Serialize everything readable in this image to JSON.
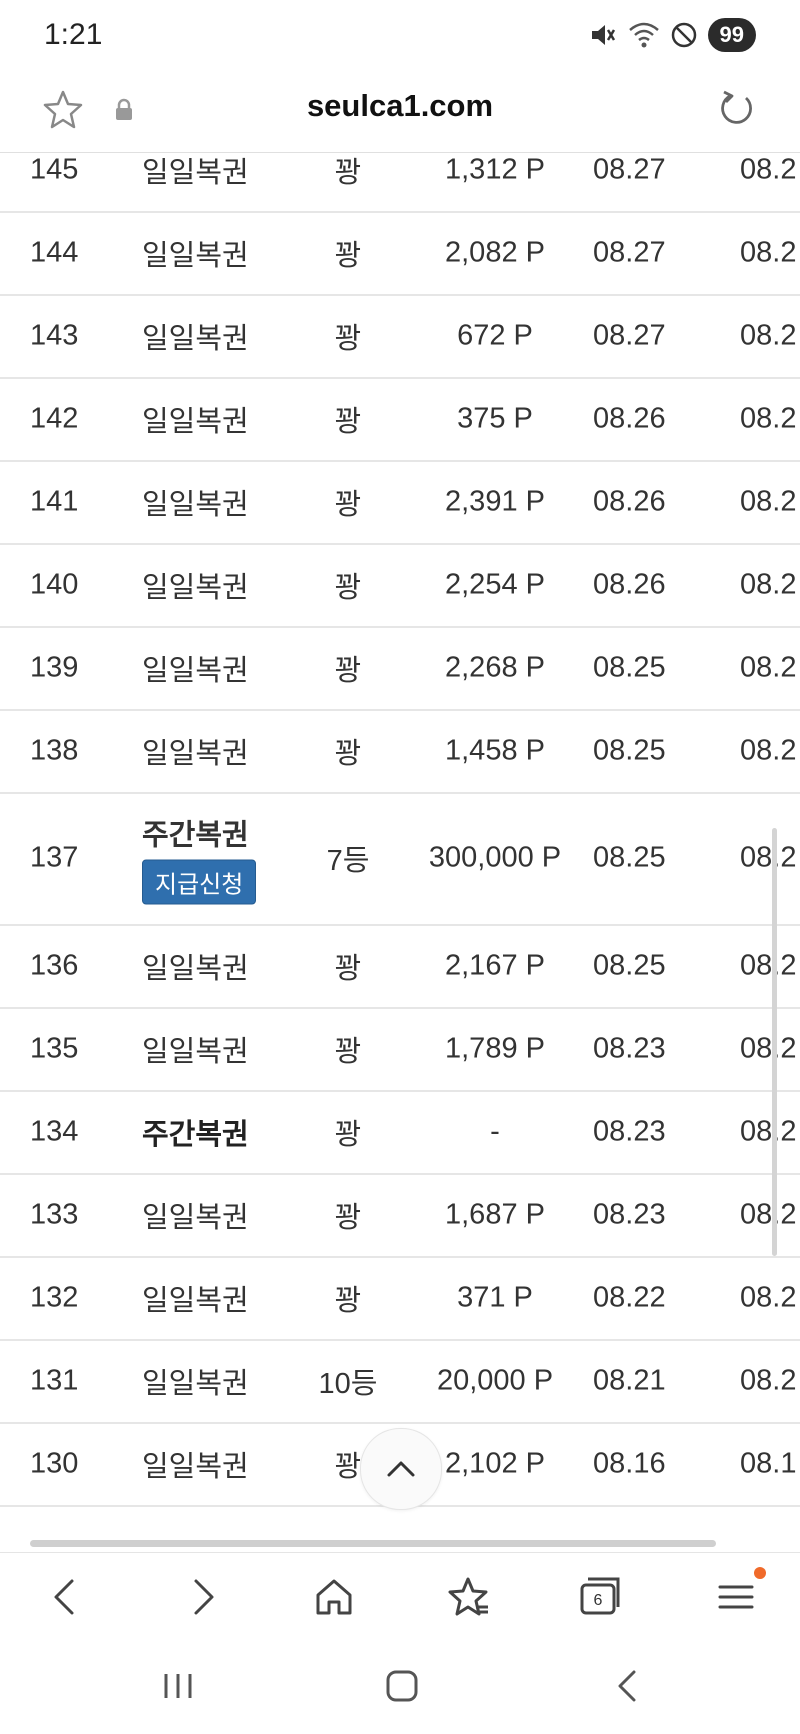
{
  "status_bar": {
    "time": "1:21",
    "battery": "99",
    "icons": [
      "mute-icon",
      "wifi-icon",
      "do-not-disturb-icon"
    ]
  },
  "browser": {
    "url": "seulca1.com",
    "icons": [
      "star-icon",
      "lock-icon",
      "reload-icon"
    ]
  },
  "table": {
    "rows": [
      {
        "num": "145",
        "type": "일일복권",
        "type_bold": false,
        "rank": "꽝",
        "amount": "1,312 P",
        "date1": "08.27",
        "date2": "08.2"
      },
      {
        "num": "144",
        "type": "일일복권",
        "type_bold": false,
        "rank": "꽝",
        "amount": "2,082 P",
        "date1": "08.27",
        "date2": "08.2"
      },
      {
        "num": "143",
        "type": "일일복권",
        "type_bold": false,
        "rank": "꽝",
        "amount": "672 P",
        "date1": "08.27",
        "date2": "08.2"
      },
      {
        "num": "142",
        "type": "일일복권",
        "type_bold": false,
        "rank": "꽝",
        "amount": "375 P",
        "date1": "08.26",
        "date2": "08.2"
      },
      {
        "num": "141",
        "type": "일일복권",
        "type_bold": false,
        "rank": "꽝",
        "amount": "2,391 P",
        "date1": "08.26",
        "date2": "08.2"
      },
      {
        "num": "140",
        "type": "일일복권",
        "type_bold": false,
        "rank": "꽝",
        "amount": "2,254 P",
        "date1": "08.26",
        "date2": "08.2"
      },
      {
        "num": "139",
        "type": "일일복권",
        "type_bold": false,
        "rank": "꽝",
        "amount": "2,268 P",
        "date1": "08.25",
        "date2": "08.2"
      },
      {
        "num": "138",
        "type": "일일복권",
        "type_bold": false,
        "rank": "꽝",
        "amount": "1,458 P",
        "date1": "08.25",
        "date2": "08.2"
      },
      {
        "num": "137",
        "type": "주간복권",
        "type_bold": true,
        "button": "지급신청",
        "rank": "7등",
        "amount": "300,000 P",
        "date1": "08.25",
        "date2": "08.2"
      },
      {
        "num": "136",
        "type": "일일복권",
        "type_bold": false,
        "rank": "꽝",
        "amount": "2,167 P",
        "date1": "08.25",
        "date2": "08.2"
      },
      {
        "num": "135",
        "type": "일일복권",
        "type_bold": false,
        "rank": "꽝",
        "amount": "1,789 P",
        "date1": "08.23",
        "date2": "08.2"
      },
      {
        "num": "134",
        "type": "주간복권",
        "type_bold": true,
        "rank": "꽝",
        "amount": "-",
        "date1": "08.23",
        "date2": "08.2"
      },
      {
        "num": "133",
        "type": "일일복권",
        "type_bold": false,
        "rank": "꽝",
        "amount": "1,687 P",
        "date1": "08.23",
        "date2": "08.2"
      },
      {
        "num": "132",
        "type": "일일복권",
        "type_bold": false,
        "rank": "꽝",
        "amount": "371 P",
        "date1": "08.22",
        "date2": "08.2"
      },
      {
        "num": "131",
        "type": "일일복권",
        "type_bold": false,
        "rank": "10등",
        "amount": "20,000 P",
        "date1": "08.21",
        "date2": "08.2"
      },
      {
        "num": "130",
        "type": "일일복권",
        "type_bold": false,
        "rank": "꽝",
        "amount": "2,102 P",
        "date1": "08.16",
        "date2": "08.1"
      }
    ]
  },
  "bottom_nav": {
    "tabs_count": "6",
    "icons": [
      "back-icon",
      "forward-icon",
      "home-icon",
      "bookmarks-icon",
      "tabs-icon",
      "menu-icon"
    ]
  },
  "system_nav": {
    "icons": [
      "recent-apps-icon",
      "home-button-icon",
      "system-back-icon"
    ]
  },
  "colors": {
    "button_bg": "#2f6fae",
    "notification_dot": "#f06a2a",
    "row_divider": "#e6e6e6"
  }
}
